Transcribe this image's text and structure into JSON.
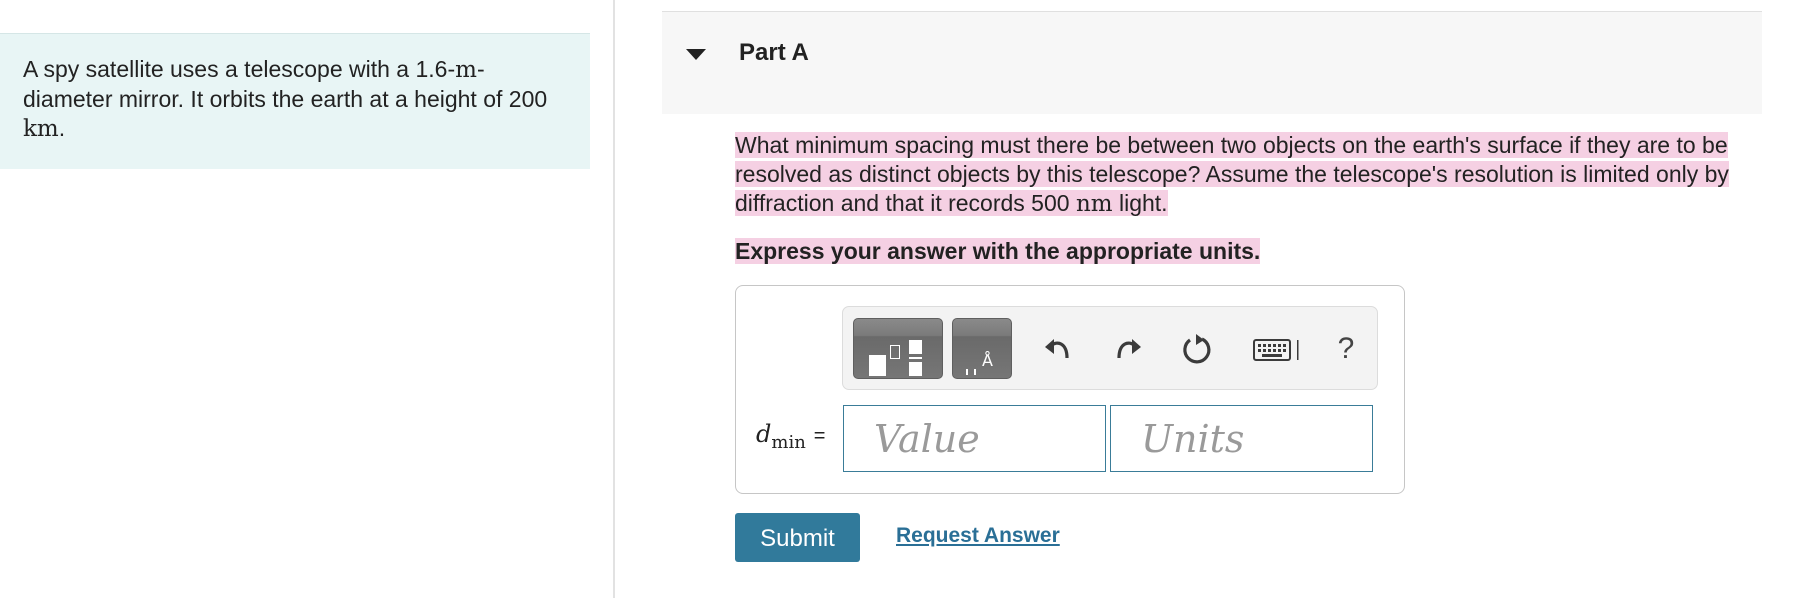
{
  "problem": {
    "text_before_m": "A spy satellite uses a telescope with a 1.6-",
    "unit_m": "m",
    "text_after_m": "-diameter mirror. It orbits the earth at a height of 200 ",
    "unit_km": "km",
    "text_end": "."
  },
  "part": {
    "title": "Part A",
    "collapse_icon": "caret-down-icon"
  },
  "question": {
    "text_main": "What minimum spacing must there be between two objects on the earth's surface if they are to be resolved as distinct objects by this telescope? Assume the telescope's resolution is limited only by diffraction and that it records 500 ",
    "unit_nm": "nm",
    "text_end": " light.",
    "instruction": "Express your answer with the appropriate units."
  },
  "answer": {
    "variable": "d",
    "subscript": "min",
    "equals": "=",
    "value_placeholder": "Value",
    "units_placeholder": "Units",
    "toolbar_icons": [
      "templates-icon",
      "units-symbol-icon",
      "undo-icon",
      "redo-icon",
      "reset-icon",
      "keyboard-icon",
      "help-icon"
    ],
    "help_label": "?"
  },
  "actions": {
    "submit_label": "Submit",
    "request_label": "Request Answer"
  },
  "colors": {
    "highlight": "#f5d0e3",
    "problem_bg": "#e8f5f5",
    "submit_bg": "#317a9b",
    "link": "#2a6f96",
    "field_border": "#3a7c98"
  }
}
